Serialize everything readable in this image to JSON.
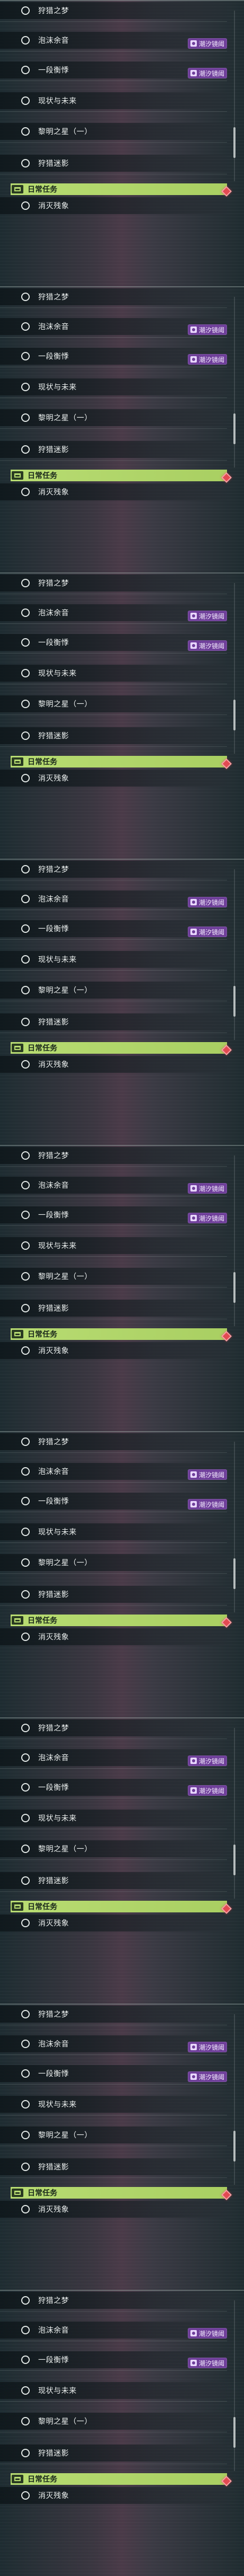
{
  "panel_count": 9,
  "missions": [
    {
      "label": "狩猎之梦"
    },
    {
      "label": "泡沫余音"
    },
    {
      "label": "一段衡悸",
      "tag": "潮汐镜阈"
    },
    {
      "label": "现状与未来",
      "tag": "潮汐镜阈"
    },
    {
      "label": "黎明之星（一）"
    },
    {
      "label": "狩猎迷影"
    }
  ],
  "tag_icon": "tide-mirror-icon",
  "daily_section": {
    "title": "日常任务",
    "icon": "calendar-icon",
    "item": "消灭残象",
    "marker_icon": "red-diamond-icon"
  },
  "colors": {
    "tag_bg": "#6f3f9a",
    "daily_bg": "#b8dc72",
    "marker": "#e24a52"
  }
}
